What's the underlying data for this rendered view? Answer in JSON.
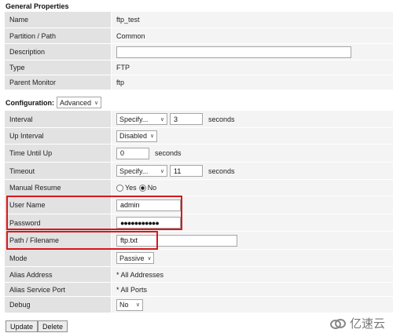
{
  "general": {
    "header": "General Properties",
    "rows": [
      {
        "label": "Name",
        "value": "ftp_test"
      },
      {
        "label": "Partition / Path",
        "value": "Common"
      },
      {
        "label": "Description",
        "value": ""
      },
      {
        "label": "Type",
        "value": "FTP"
      },
      {
        "label": "Parent Monitor",
        "value": "ftp"
      }
    ]
  },
  "configuration": {
    "label": "Configuration:",
    "mode_select": "Advanced",
    "interval": {
      "label": "Interval",
      "select": "Specify...",
      "value": "3",
      "unit": "seconds"
    },
    "up_interval": {
      "label": "Up Interval",
      "select": "Disabled"
    },
    "time_until_up": {
      "label": "Time Until Up",
      "value": "0",
      "unit": "seconds"
    },
    "timeout": {
      "label": "Timeout",
      "select": "Specify...",
      "value": "11",
      "unit": "seconds"
    },
    "manual_resume": {
      "label": "Manual Resume",
      "yes": "Yes",
      "no": "No",
      "selected": "No"
    },
    "user_name": {
      "label": "User Name",
      "value": "admin"
    },
    "password": {
      "label": "Password",
      "value": "●●●●●●●●●●●"
    },
    "path_filename": {
      "label": "Path / Filename",
      "value": "ftp.txt"
    },
    "mode": {
      "label": "Mode",
      "select": "Passive"
    },
    "alias_address": {
      "label": "Alias Address",
      "value": "* All Addresses"
    },
    "alias_service_port": {
      "label": "Alias Service Port",
      "value": "* All Ports"
    },
    "debug": {
      "label": "Debug",
      "select": "No"
    }
  },
  "buttons": {
    "update": "Update",
    "delete": "Delete"
  },
  "watermark": {
    "text": "亿速云"
  },
  "colors": {
    "highlight": "#d7191c",
    "label_bg": "#e2e2e2",
    "value_bg": "#f4f4f4"
  }
}
